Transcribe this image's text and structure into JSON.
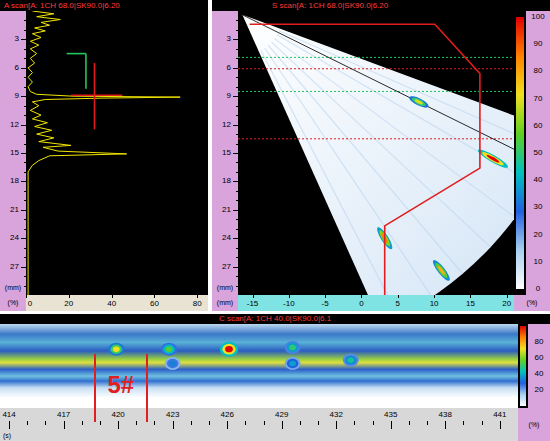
{
  "a_scan": {
    "title": "A scan[A: 1CH 68.0|SK90.0|6.20",
    "y_ticks": [
      "3",
      "6",
      "9",
      "12",
      "15",
      "18",
      "21",
      "24",
      "27"
    ],
    "y_unit": "(mm)",
    "x_ticks": [
      "0",
      "20",
      "40",
      "60",
      "80"
    ],
    "x_unit": "(%)",
    "waveform": [
      [
        0,
        3
      ],
      [
        0.3,
        13
      ],
      [
        0.6,
        5
      ],
      [
        0.9,
        16
      ],
      [
        1.2,
        7
      ],
      [
        1.5,
        11
      ],
      [
        1.8,
        4
      ],
      [
        2.1,
        9
      ],
      [
        2.4,
        3
      ],
      [
        2.8,
        7
      ],
      [
        3.2,
        2
      ],
      [
        3.6,
        6
      ],
      [
        4,
        2
      ],
      [
        4.5,
        5
      ],
      [
        5,
        2
      ],
      [
        5.5,
        4
      ],
      [
        6,
        1
      ],
      [
        6.5,
        3
      ],
      [
        7,
        1
      ],
      [
        7.5,
        3
      ],
      [
        8,
        1
      ],
      [
        8.5,
        2
      ],
      [
        8.8,
        5
      ],
      [
        9,
        22
      ],
      [
        9.1,
        72
      ],
      [
        9.2,
        36
      ],
      [
        9.35,
        9
      ],
      [
        9.6,
        3
      ],
      [
        10,
        6
      ],
      [
        10.5,
        2
      ],
      [
        11,
        7
      ],
      [
        11.4,
        3
      ],
      [
        11.8,
        10
      ],
      [
        12.2,
        4
      ],
      [
        12.6,
        12
      ],
      [
        13,
        5
      ],
      [
        13.4,
        13
      ],
      [
        13.8,
        6
      ],
      [
        14.2,
        21
      ],
      [
        14.4,
        8
      ],
      [
        14.8,
        15
      ],
      [
        15.1,
        47
      ],
      [
        15.3,
        11
      ],
      [
        15.8,
        6
      ],
      [
        16.3,
        3
      ],
      [
        17,
        1
      ],
      [
        18,
        1
      ],
      [
        30,
        1
      ]
    ],
    "gates": [
      {
        "kind": "bracket",
        "start_depth": 4.5,
        "end_depth": 8.2,
        "threshold": 28,
        "color": "#22c55e"
      },
      {
        "kind": "cross",
        "start_depth": 5.5,
        "end_depth": 12.5,
        "threshold": 32,
        "color": "#e11d1d"
      }
    ]
  },
  "s_scan": {
    "title": "S scan[A: 1CH 68.0|SK90.0|6.20",
    "y_ticks": [
      "3",
      "6",
      "9",
      "12",
      "15",
      "18",
      "21",
      "24",
      "27"
    ],
    "y_unit": "(mm)",
    "x_ticks": [
      "-15",
      "-10",
      "-5",
      "0",
      "5",
      "10",
      "15",
      "20"
    ],
    "x_unit": "(mm)",
    "color_scale": [
      "100",
      "90",
      "80",
      "70",
      "60",
      "50",
      "40",
      "30",
      "20",
      "10",
      "0"
    ],
    "color_unit": "(%)",
    "reference_lines": [
      {
        "depth": 4.9,
        "color": "#22c55e"
      },
      {
        "depth": 6.1,
        "color": "#e11d1d"
      },
      {
        "depth": 8.5,
        "color": "#22c55e"
      },
      {
        "depth": 13.5,
        "color": "#e11d1d"
      }
    ],
    "cursor": [
      [
        -16.4,
        0.4
      ],
      [
        21,
        14.6
      ]
    ],
    "weld_profile": [
      [
        -15.4,
        1.4
      ],
      [
        10.1,
        1.4
      ],
      [
        16.3,
        6.6
      ],
      [
        16.3,
        16.6
      ],
      [
        3.2,
        22.7
      ],
      [
        3.2,
        30
      ]
    ],
    "indications": [
      {
        "x": 7.9,
        "depth": 9.6,
        "amplitude": 78,
        "length": 2.4
      },
      {
        "x": 18.1,
        "depth": 15.6,
        "amplitude": 100,
        "length": 4.2
      },
      {
        "x": 3.2,
        "depth": 24,
        "amplitude": 90,
        "length": 3
      },
      {
        "x": 11,
        "depth": 27.4,
        "amplitude": 85,
        "length": 3
      }
    ]
  },
  "c_scan": {
    "title": "C scan[A: 1CH 40.0|SK90.0|6.1",
    "x_ticks": [
      "414",
      "417",
      "420",
      "423",
      "426",
      "429",
      "432",
      "435",
      "438",
      "441"
    ],
    "x_unit": "(s)",
    "color_scale": [
      "80",
      "60",
      "40",
      "20"
    ],
    "color_unit": "(%)",
    "marker": {
      "label": "5#",
      "start": 418.7,
      "end": 421.6
    },
    "indications": [
      {
        "position": 419.9,
        "index": 6,
        "amplitude": 80
      },
      {
        "position": 422.8,
        "index": 6,
        "amplitude": 68
      },
      {
        "position": 426.1,
        "index": 6,
        "amplitude": 100
      },
      {
        "position": 429.6,
        "index": 5.6,
        "amplitude": 62
      },
      {
        "position": 432.8,
        "index": 8.6,
        "amplitude": 58
      },
      {
        "position": 429.6,
        "index": 9.4,
        "amplitude": 50
      },
      {
        "position": 423,
        "index": 9.4,
        "amplitude": 45
      }
    ]
  }
}
